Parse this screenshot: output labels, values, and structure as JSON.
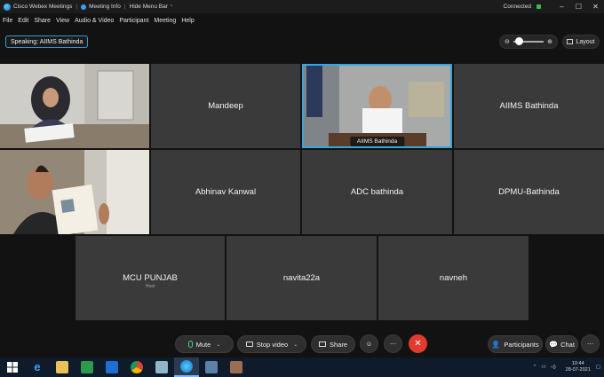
{
  "titlebar": {
    "app_name": "Cisco Webex Meetings",
    "meeting_info": "Meeting Info",
    "hide_menu_bar": "Hide Menu Bar",
    "status": "Connected"
  },
  "menu": [
    "File",
    "Edit",
    "Share",
    "View",
    "Audio & Video",
    "Participant",
    "Meeting",
    "Help"
  ],
  "speaking": "Speaking: AIIMS Bathinda",
  "layout_label": "Layout",
  "tiles": {
    "r1": [
      "",
      "Mandeep",
      "AIIMS Bathinda",
      "AIIMS Bathinda"
    ],
    "r2": [
      "",
      "Abhinav Kanwal",
      "ADC bathinda",
      "DPMU-Bathinda"
    ],
    "r3": [
      "MCU PUNJAB",
      "navita22a",
      "navneh"
    ],
    "host_label": "Host"
  },
  "controls": {
    "mute": "Mute",
    "stop_video": "Stop video",
    "share": "Share",
    "participants": "Participants",
    "chat": "Chat"
  },
  "taskbar": {
    "time": "10:44",
    "date": "28-07-2021"
  },
  "colors": {
    "accent": "#32a8e0",
    "leave": "#e23b2e",
    "connected": "#3fb950"
  }
}
